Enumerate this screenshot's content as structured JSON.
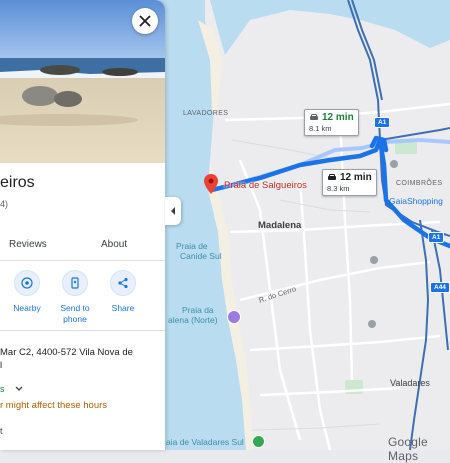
{
  "map": {
    "labels": {
      "lavadores": "LAVADORES",
      "coimbroes": "COIMBRÕES",
      "madalena": "Madalena",
      "valadares": "Valadares",
      "praia_canide_1": "Praia de",
      "praia_canide_2": "Canide Sul",
      "praia_madalena_1": "Praia da",
      "praia_madalena_2": "alena (Norte)",
      "praia_valadares": "aia de Valadares Sul",
      "road_cerro": "R. do Cerro",
      "gaia_shopping": "GaiaShopping",
      "pin_place": "Praia de Salgueiros"
    },
    "shields": {
      "a1": "A1",
      "a44": "A44",
      "a1b": "A1"
    },
    "route_primary": {
      "time": "12 min",
      "distance": "8.3 km"
    },
    "route_alt": {
      "time": "12 min",
      "distance": "8.1 km"
    },
    "attribution": "Google Maps",
    "colors": {
      "route": "#1a73e8",
      "route_alt": "#a8c7fa",
      "water": "#b9dcf1",
      "land": "#ececee",
      "highway": "#3c6fb6"
    }
  },
  "panel": {
    "close_icon": "close-icon",
    "title": "eiros",
    "rating_fragment": "4)",
    "tabs": [
      "Reviews",
      "About"
    ],
    "actions": [
      {
        "label": "Nearby",
        "icon": "nearby-icon"
      },
      {
        "label": "Send to phone",
        "icon": "send-to-phone-icon"
      },
      {
        "label": "Share",
        "icon": "share-icon"
      }
    ],
    "address": "Mar C2, 4400-572 Vila Nova de",
    "address_cont": "l",
    "hours_fragment": "s",
    "hours_note": "r might affect these hours",
    "bottom_fragment": "t"
  }
}
